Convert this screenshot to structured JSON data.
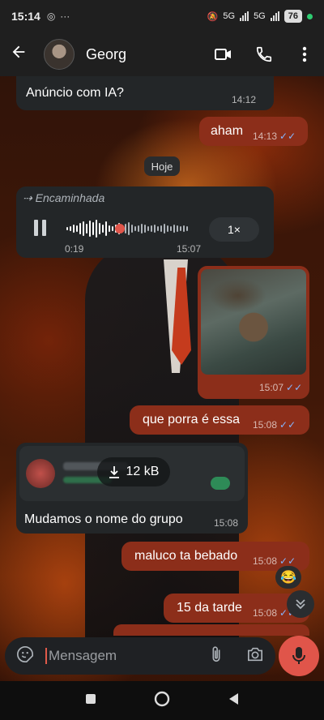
{
  "status_bar": {
    "time": "15:14",
    "network_5g_1": "5G",
    "network_5g_2": "5G",
    "battery": "76"
  },
  "header": {
    "contact_name": "Georg"
  },
  "messages": {
    "m1": {
      "text": "Anúncio com IA?",
      "time": "14:12"
    },
    "m2": {
      "text": "aham",
      "time": "14:13"
    },
    "date_separator": "Hoje",
    "voice": {
      "forwarded_label": "Encaminhada",
      "duration": "0:19",
      "time": "15:07",
      "speed": "1×"
    },
    "image_msg": {
      "time": "15:07"
    },
    "m3": {
      "text": "que porra é essa",
      "time": "15:08"
    },
    "doc_msg": {
      "size": "12 kB",
      "caption": "Mudamos o nome do grupo",
      "time": "15:08"
    },
    "m4": {
      "text": "maluco ta bebado",
      "time": "15:08"
    },
    "reaction": "😂",
    "m5": {
      "text": "15 da tarde",
      "time": "15:08"
    }
  },
  "composer": {
    "placeholder": "Mensagem"
  },
  "colors": {
    "outgoing_bubble": "#8c2e1a",
    "incoming_bubble": "#232628",
    "read_ticks": "#86b6ff",
    "mic_button": "#e0554a"
  }
}
